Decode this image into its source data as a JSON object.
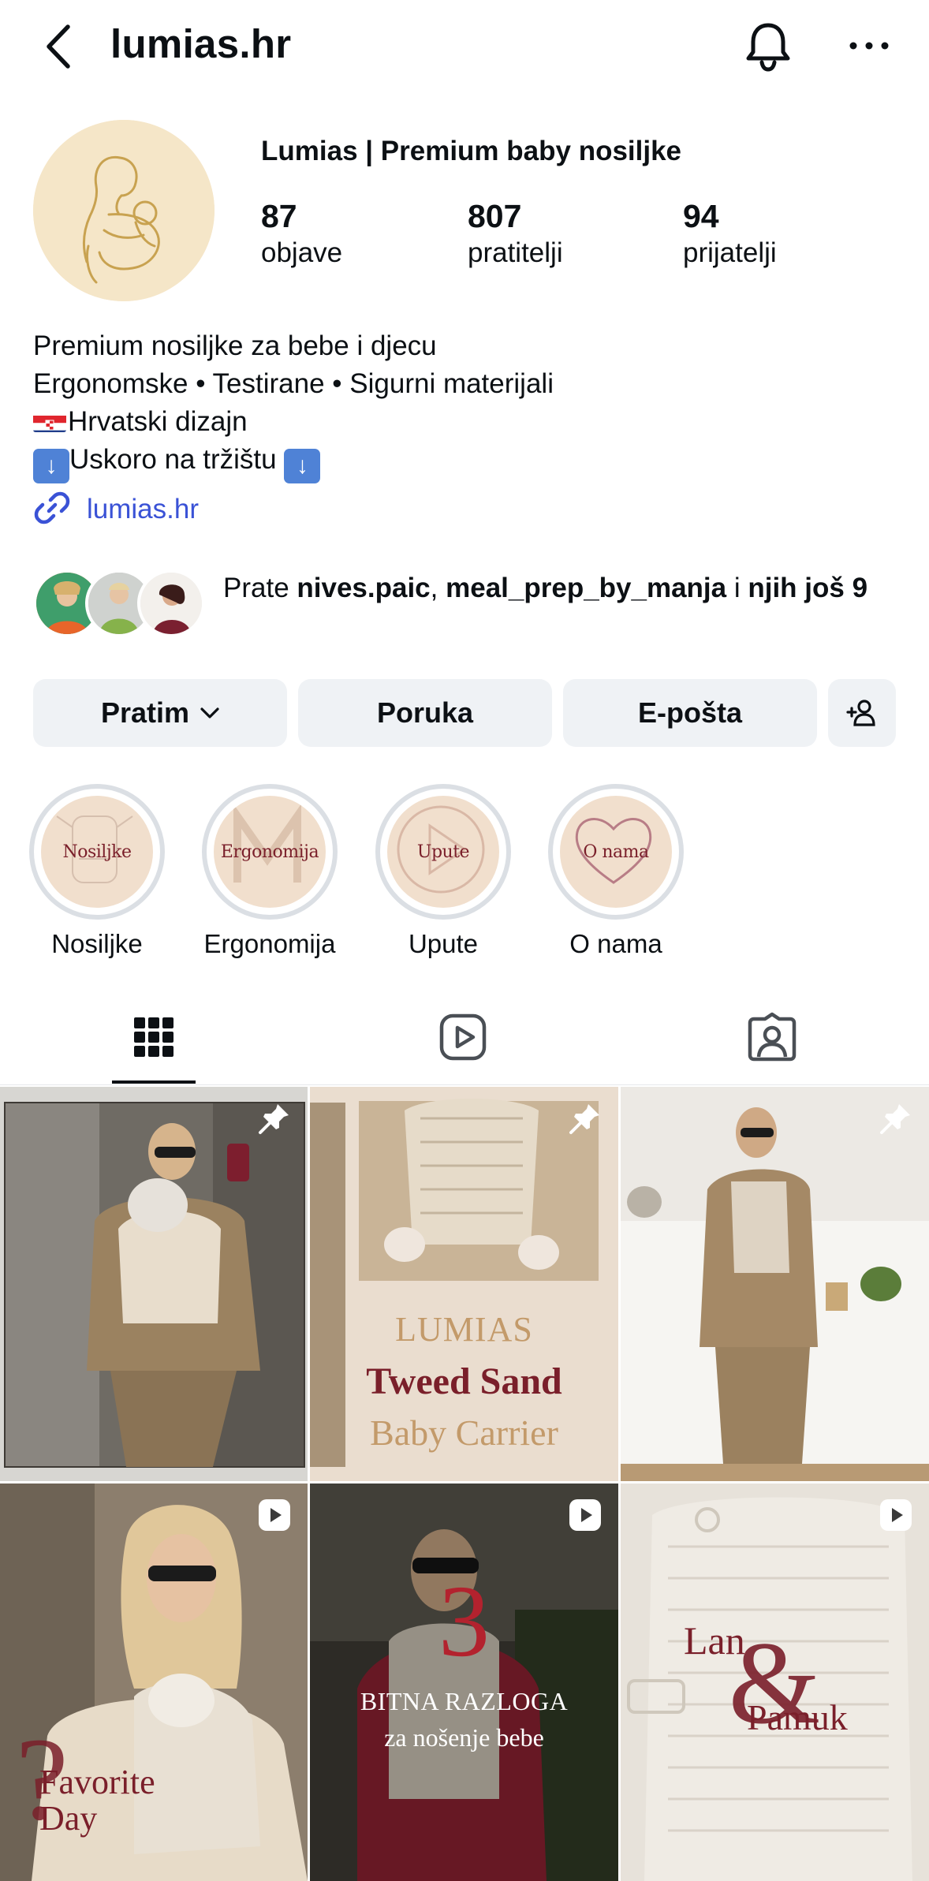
{
  "header": {
    "title": "lumias.hr"
  },
  "profile": {
    "display_name": "Lumias | Premium baby nosiljke",
    "stats": [
      {
        "value": "87",
        "label": "objave"
      },
      {
        "value": "807",
        "label": "pratitelji"
      },
      {
        "value": "94",
        "label": "prijatelji"
      }
    ],
    "bio": {
      "line1": "Premium nosiljke za bebe i djecu",
      "line2": "Ergonomske • Testirane • Sigurni materijali",
      "line3": "Hrvatski dizajn",
      "line4": "Uskoro na tržištu "
    },
    "link": "lumias.hr"
  },
  "followed_by": {
    "prefix": "Prate ",
    "user1": "nives.paic",
    "sep": ", ",
    "user2": "meal_prep_by_manja",
    "and": " i ",
    "more": "njih još 9"
  },
  "buttons": {
    "following": "Pratim",
    "message": "Poruka",
    "email": "E-pošta"
  },
  "highlights": [
    {
      "cover_text": "Nosiljke",
      "label": "Nosiljke"
    },
    {
      "cover_text": "Ergonomija",
      "label": "Ergonomija"
    },
    {
      "cover_text": "Upute",
      "label": "Upute"
    },
    {
      "cover_text": "O nama",
      "label": "O nama"
    }
  ],
  "posts": {
    "p2": {
      "line1": "LUMIAS",
      "line2": "Tweed Sand",
      "line3": "Baby Carrier"
    },
    "p4": {
      "line1": "Favorite",
      "line2": "Day"
    },
    "p5": {
      "line1": "3",
      "line2": "BITNA RAZLOGA",
      "line3": "za nošenje bebe"
    },
    "p6": {
      "line1": "Lan",
      "line2": "&",
      "line3": "Pamuk"
    }
  },
  "colors": {
    "accent_link": "#3a52d6",
    "button_bg": "#eff2f5",
    "brand_burgundy": "#7a1f2a",
    "brand_cream": "#f1dfcd"
  }
}
